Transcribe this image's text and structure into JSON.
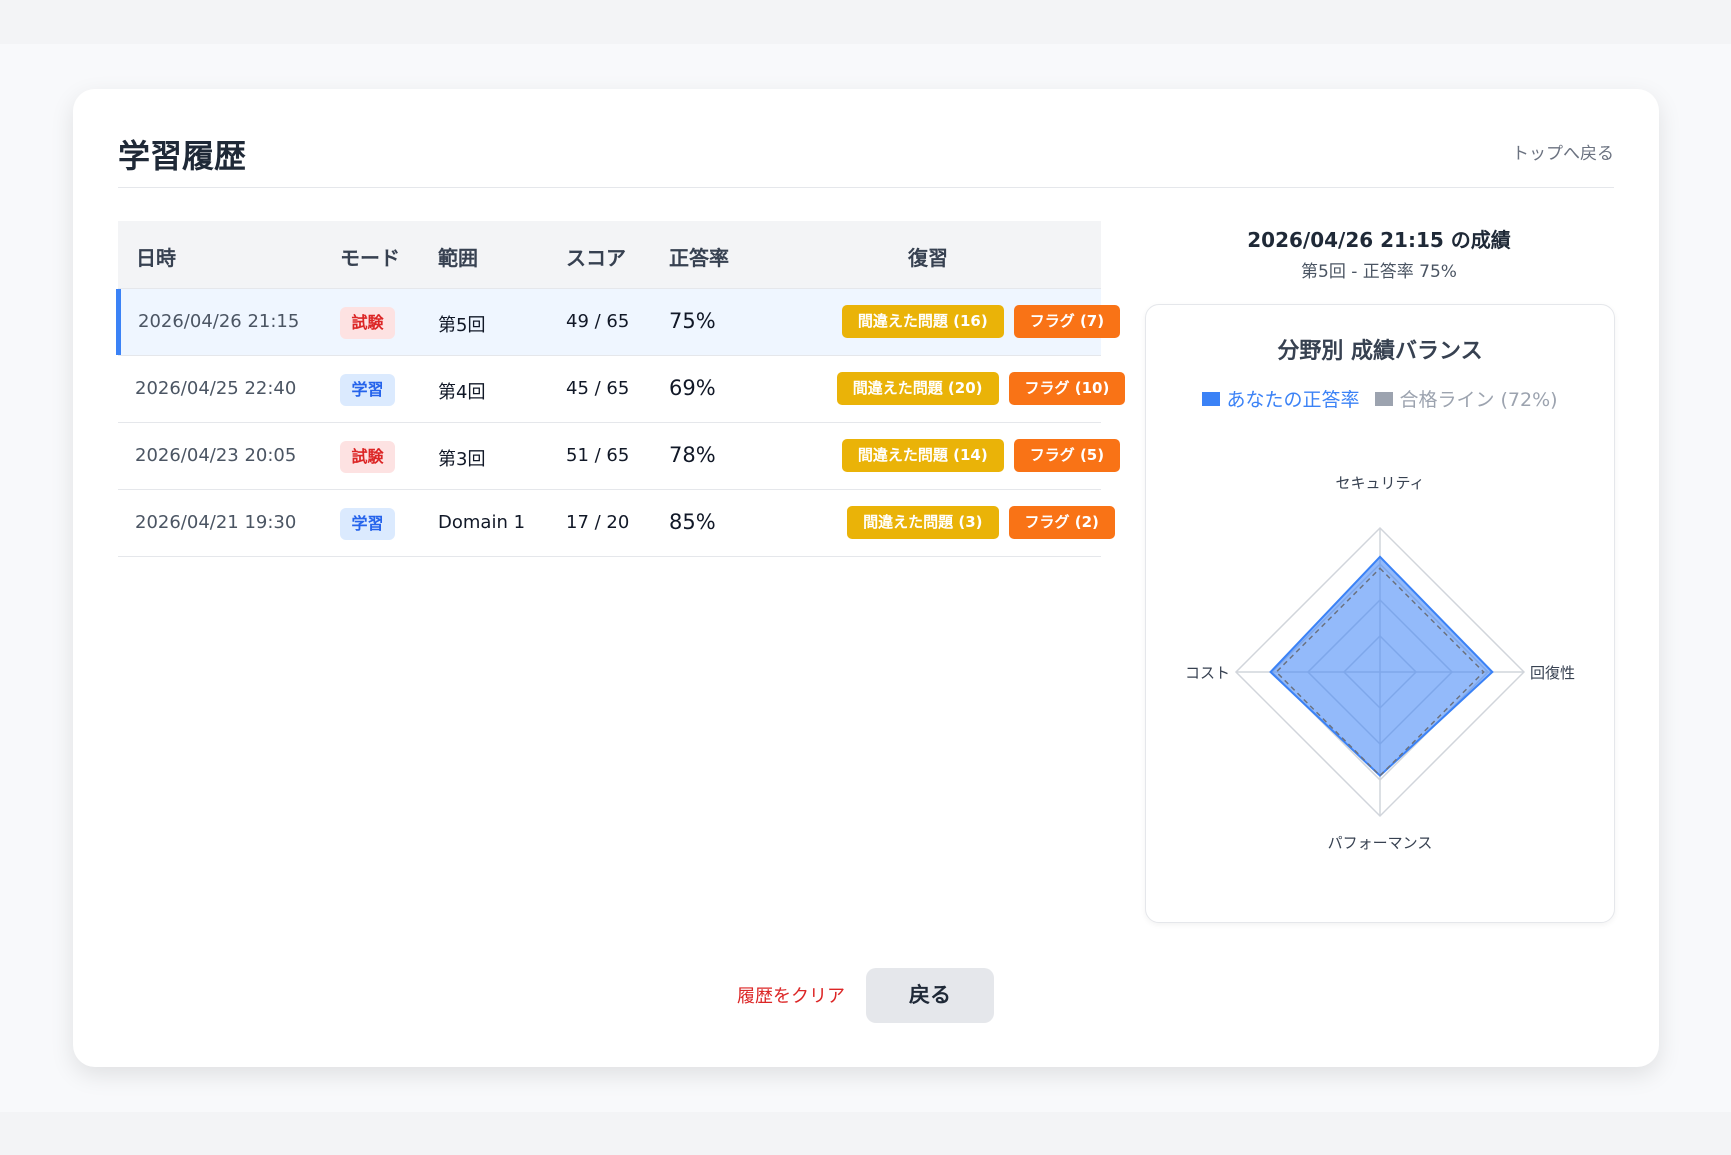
{
  "header": {
    "title": "学習履歴",
    "top_link": "トップへ戻る"
  },
  "table": {
    "columns": [
      "日時",
      "モード",
      "範囲",
      "スコア",
      "正答率",
      "復習"
    ],
    "rows": [
      {
        "date": "2026/04/26 21:15",
        "mode": "試験",
        "mode_kind": "exam",
        "range": "第5回",
        "score": "49 / 65",
        "rate": "75%",
        "wrong": "間違えた問題 (16)",
        "flag": "フラグ (7)",
        "selected": true
      },
      {
        "date": "2026/04/25 22:40",
        "mode": "学習",
        "mode_kind": "study",
        "range": "第4回",
        "score": "45 / 65",
        "rate": "69%",
        "wrong": "間違えた問題 (20)",
        "flag": "フラグ (10)",
        "selected": false
      },
      {
        "date": "2026/04/23 20:05",
        "mode": "試験",
        "mode_kind": "exam",
        "range": "第3回",
        "score": "51 / 65",
        "rate": "78%",
        "wrong": "間違えた問題 (14)",
        "flag": "フラグ (5)",
        "selected": false
      },
      {
        "date": "2026/04/21 19:30",
        "mode": "学習",
        "mode_kind": "study",
        "range": "Domain 1",
        "score": "17 / 20",
        "rate": "85%",
        "wrong": "間違えた問題 (3)",
        "flag": "フラグ (2)",
        "selected": false
      }
    ]
  },
  "side": {
    "title": "2026/04/26 21:15 の成績",
    "subtitle": "第5回 - 正答率 75%"
  },
  "chart_data": {
    "type": "radar",
    "title": "分野別 成績バランス",
    "axes": [
      "セキュリティ",
      "回復性",
      "パフォーマンス",
      "コスト"
    ],
    "series": [
      {
        "name": "あなたの正答率",
        "values": [
          80,
          78,
          72,
          76
        ],
        "color": "#3b82f6"
      },
      {
        "name": "合格ライン (72%)",
        "values": [
          72,
          72,
          72,
          72
        ],
        "color": "#9ca3af"
      }
    ],
    "rmax": 100,
    "rings": 4
  },
  "footer": {
    "clear_label": "履歴をクリア",
    "back_label": "戻る"
  }
}
